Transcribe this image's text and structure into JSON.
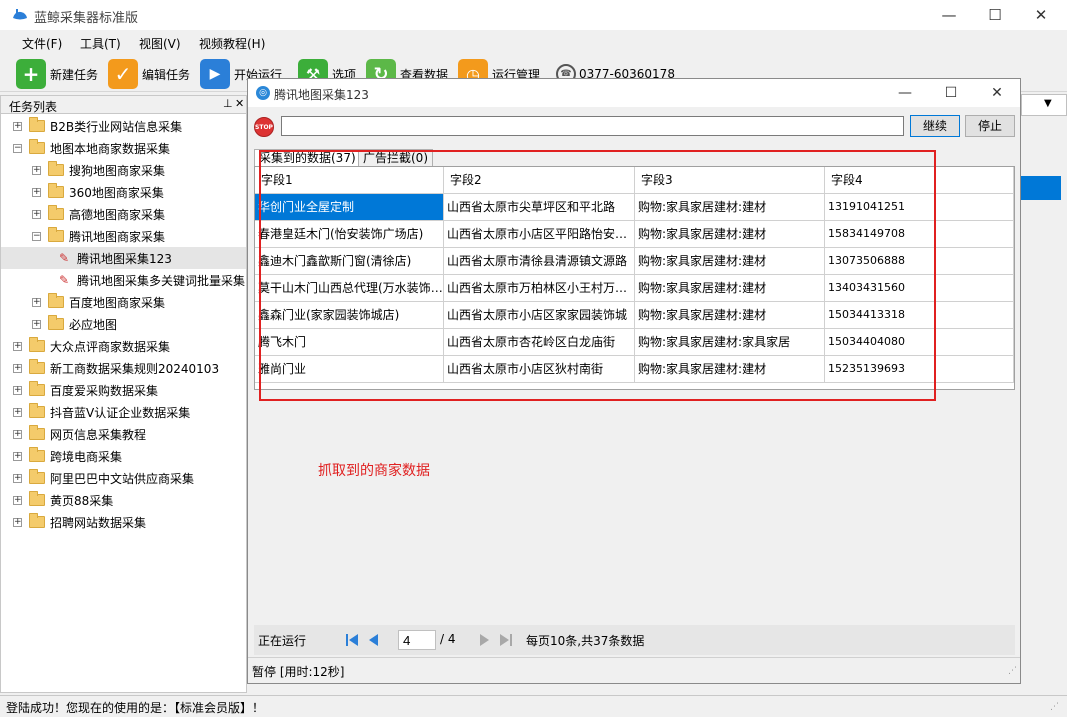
{
  "window": {
    "title": "蓝鲸采集器标准版"
  },
  "menu": [
    "文件(F)",
    "工具(T)",
    "视图(V)",
    "视频教程(H)"
  ],
  "toolbar": {
    "new_task": "新建任务",
    "edit_task": "编辑任务",
    "start_run": "开始运行",
    "options": "选项",
    "view_data": "查看数据",
    "run_manage": "运行管理",
    "phone": "0377-60360178"
  },
  "task_panel": {
    "title": "任务列表",
    "items": [
      {
        "label": "B2B类行业网站信息采集",
        "level": 0,
        "expander": "+",
        "kind": "folder"
      },
      {
        "label": "地图本地商家数据采集",
        "level": 0,
        "expander": "−",
        "kind": "folder"
      },
      {
        "label": "搜狗地图商家采集",
        "level": 1,
        "expander": "+",
        "kind": "folder"
      },
      {
        "label": "360地图商家采集",
        "level": 1,
        "expander": "+",
        "kind": "folder"
      },
      {
        "label": "高德地图商家采集",
        "level": 1,
        "expander": "+",
        "kind": "folder"
      },
      {
        "label": "腾讯地图商家采集",
        "level": 1,
        "expander": "−",
        "kind": "folder"
      },
      {
        "label": "腾讯地图采集123",
        "level": 2,
        "expander": "",
        "kind": "task"
      },
      {
        "label": "腾讯地图采集多关键词批量采集",
        "level": 2,
        "expander": "",
        "kind": "task"
      },
      {
        "label": "百度地图商家采集",
        "level": 1,
        "expander": "+",
        "kind": "folder"
      },
      {
        "label": "必应地图",
        "level": 1,
        "expander": "+",
        "kind": "folder"
      },
      {
        "label": "大众点评商家数据采集",
        "level": 0,
        "expander": "+",
        "kind": "folder"
      },
      {
        "label": "新工商数据采集规则20240103",
        "level": 0,
        "expander": "+",
        "kind": "folder"
      },
      {
        "label": "百度爱采购数据采集",
        "level": 0,
        "expander": "+",
        "kind": "folder"
      },
      {
        "label": "抖音蓝V认证企业数据采集",
        "level": 0,
        "expander": "+",
        "kind": "folder"
      },
      {
        "label": "网页信息采集教程",
        "level": 0,
        "expander": "+",
        "kind": "folder"
      },
      {
        "label": "跨境电商采集",
        "level": 0,
        "expander": "+",
        "kind": "folder"
      },
      {
        "label": "阿里巴巴中文站供应商采集",
        "level": 0,
        "expander": "+",
        "kind": "folder"
      },
      {
        "label": "黄页88采集",
        "level": 0,
        "expander": "+",
        "kind": "folder"
      },
      {
        "label": "招聘网站数据采集",
        "level": 0,
        "expander": "+",
        "kind": "folder"
      }
    ]
  },
  "dialog": {
    "title": "腾讯地图采集123",
    "url_value": "",
    "continue_label": "继续",
    "stop_label": "停止",
    "tabs": [
      "采集到的数据(37)",
      "广告拦截(0)"
    ],
    "columns": [
      "字段1",
      "字段2",
      "字段3",
      "字段4"
    ],
    "rows": [
      [
        "华创门业全屋定制",
        "山西省太原市尖草坪区和平北路",
        "购物:家具家居建材:建材",
        "13191041251"
      ],
      [
        "春港皇廷木门(怡安装饰广场店)",
        "山西省太原市小店区平阳路怡安装饰广场",
        "购物:家具家居建材:建材",
        "15834149708"
      ],
      [
        "鑫迪木门鑫歆斯门窗(清徐店)",
        "山西省太原市清徐县清源镇文源路",
        "购物:家具家居建材:建材",
        "13073506888"
      ],
      [
        "莫干山木门山西总代理(万水装饰城)",
        "山西省太原市万柏林区小王村万水装饰城",
        "购物:家具家居建材:建材",
        "13403431560"
      ],
      [
        "鑫森门业(家家园装饰城店)",
        "山西省太原市小店区家家园装饰城",
        "购物:家具家居建材:建材",
        "15034413318"
      ],
      [
        "腾飞木门",
        "山西省太原市杏花岭区白龙庙街",
        "购物:家具家居建材:家具家居",
        "15034404080"
      ],
      [
        "雅尚门业",
        "山西省太原市小店区狄村南街",
        "购物:家具家居建材:建材",
        "15235139693"
      ]
    ],
    "run_status": "正在运行",
    "page_current": "4",
    "page_total": "/  4",
    "page_info": "每页10条,共37条数据",
    "status": "暂停  [用时:12秒]"
  },
  "annotation": "抓取到的商家数据",
  "statusbar": "登陆成功！您现在的使用的是：【标准会员版】！",
  "colors": {
    "selection": "#0078d7",
    "annotation": "#e02020"
  }
}
